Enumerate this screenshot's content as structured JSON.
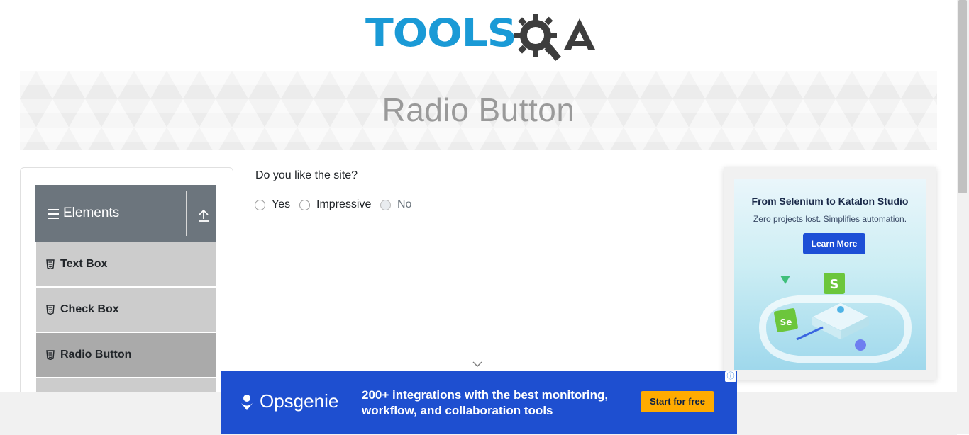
{
  "header": {
    "logo_text": "TOOLS",
    "logo_suffix": "QA",
    "brand_color": "#1a9ad6"
  },
  "banner": {
    "title": "Radio Button"
  },
  "sidebar": {
    "group": {
      "title": "Elements",
      "icon": "hamburger-icon",
      "toggle_icon": "upload-arrow-icon"
    },
    "items": [
      {
        "label": "Text Box",
        "icon": "html5-icon",
        "active": false
      },
      {
        "label": "Check Box",
        "icon": "html5-icon",
        "active": false
      },
      {
        "label": "Radio Button",
        "icon": "html5-icon",
        "active": true
      }
    ]
  },
  "main": {
    "question": "Do you like the site?",
    "options": [
      {
        "label": "Yes",
        "selected": false,
        "disabled": false
      },
      {
        "label": "Impressive",
        "selected": false,
        "disabled": false
      },
      {
        "label": "No",
        "selected": false,
        "disabled": true
      }
    ]
  },
  "right_ad": {
    "headline": "From Selenium to Katalon Studio",
    "subtext": "Zero projects lost. Simplifies automation.",
    "button": "Learn More"
  },
  "bottom_ad": {
    "brand": "Opsgenie",
    "text": "200+ integrations with the best monitoring, workflow, and collaboration tools",
    "cta": "Start for free",
    "info_glyph": "ⓘ",
    "color": "#1e4fd0",
    "cta_color": "#ffab00"
  }
}
